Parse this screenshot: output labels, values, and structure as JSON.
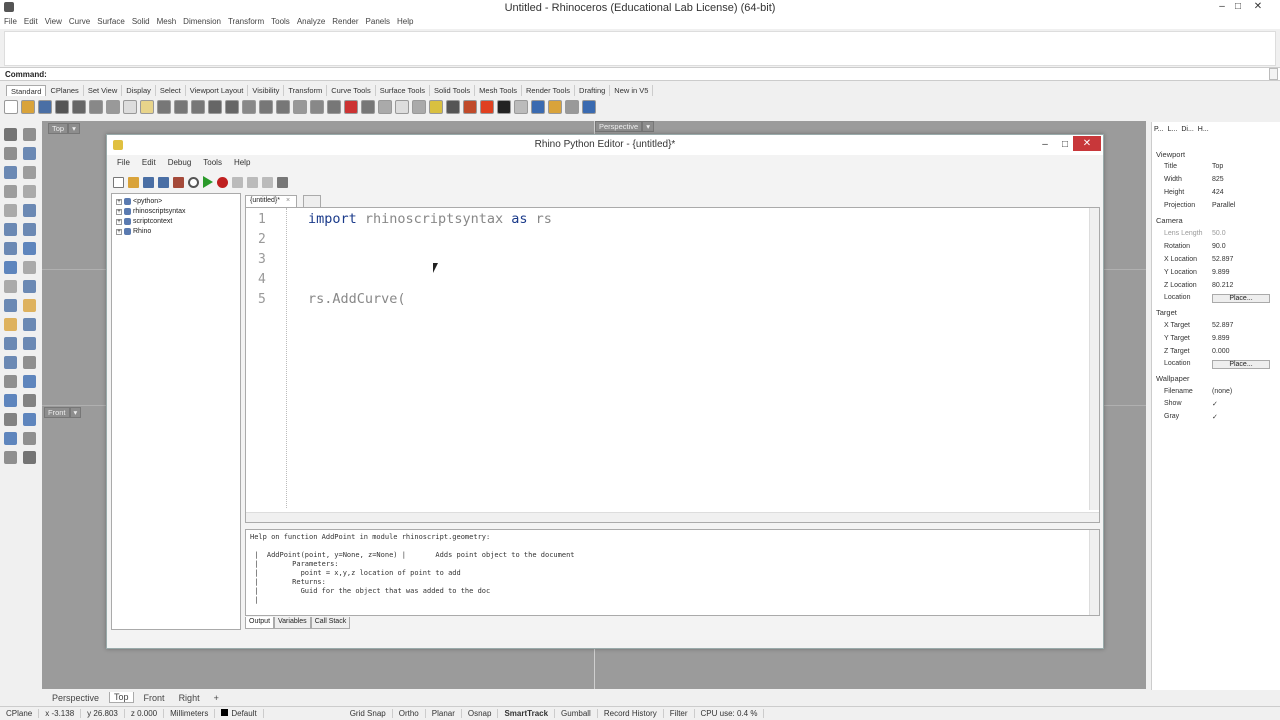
{
  "window": {
    "title": "Untitled - Rhinoceros (Educational Lab License) (64-bit)"
  },
  "menubar": [
    "File",
    "Edit",
    "View",
    "Curve",
    "Surface",
    "Solid",
    "Mesh",
    "Dimension",
    "Transform",
    "Tools",
    "Analyze",
    "Render",
    "Panels",
    "Help"
  ],
  "command": {
    "label": "Command:"
  },
  "toolbar_tabs": [
    "Standard",
    "CPlanes",
    "Set View",
    "Display",
    "Select",
    "Viewport Layout",
    "Visibility",
    "Transform",
    "Curve Tools",
    "Surface Tools",
    "Solid Tools",
    "Mesh Tools",
    "Render Tools",
    "Drafting",
    "New in V5"
  ],
  "viewports": {
    "top_label": "Top",
    "perspective_label": "Perspective",
    "front_label": "Front"
  },
  "python_editor": {
    "title": "Rhino Python Editor - {untitled}*",
    "menu": [
      "File",
      "Edit",
      "Debug",
      "Tools",
      "Help"
    ],
    "tree": [
      "<python>",
      "rhinoscriptsyntax",
      "scriptcontext",
      "Rhino"
    ],
    "tab": "{untitled}*",
    "line_numbers": [
      "1",
      "2",
      "3",
      "4",
      "5"
    ],
    "code": {
      "l1_kw1": "import",
      "l1_mid": " rhinoscriptsyntax ",
      "l1_kw2": "as",
      "l1_end": " rs",
      "l5": "rs.AddCurve("
    },
    "help": [
      "Help on function AddPoint in module rhinoscript.geometry:",
      "",
      " |  AddPoint(point, y=None, z=None) |       Adds point object to the document",
      " |        Parameters:",
      " |          point = x,y,z location of point to add",
      " |        Returns:",
      " |          Guid for the object that was added to the doc",
      " |"
    ],
    "output_tabs": [
      "Output",
      "Variables",
      "Call Stack"
    ]
  },
  "properties": {
    "tabs": [
      "P...",
      "L...",
      "Di...",
      "H..."
    ],
    "viewport_section": "Viewport",
    "camera_section": "Camera",
    "target_section": "Target",
    "wallpaper_section": "Wallpaper",
    "rows": {
      "title": {
        "label": "Title",
        "value": "Top"
      },
      "width": {
        "label": "Width",
        "value": "825"
      },
      "height": {
        "label": "Height",
        "value": "424"
      },
      "projection": {
        "label": "Projection",
        "value": "Parallel"
      },
      "lens": {
        "label": "Lens Length",
        "value": "50.0"
      },
      "rotation": {
        "label": "Rotation",
        "value": "90.0"
      },
      "xloc": {
        "label": "X Location",
        "value": "52.897"
      },
      "yloc": {
        "label": "Y Location",
        "value": "9.899"
      },
      "zloc": {
        "label": "Z Location",
        "value": "80.212"
      },
      "loc": {
        "label": "Location",
        "value": "Place..."
      },
      "xt": {
        "label": "X Target",
        "value": "52.897"
      },
      "yt": {
        "label": "Y Target",
        "value": "9.899"
      },
      "zt": {
        "label": "Z Target",
        "value": "0.000"
      },
      "tloc": {
        "label": "Location",
        "value": "Place..."
      },
      "filename": {
        "label": "Filename",
        "value": "(none)"
      },
      "show": {
        "label": "Show",
        "value": "✓"
      },
      "gray": {
        "label": "Gray",
        "value": "✓"
      }
    }
  },
  "viewport_tabs": [
    "Perspective",
    "Top",
    "Front",
    "Right"
  ],
  "status": {
    "cplane": "CPlane",
    "x": "x -3.138",
    "y": "y 26.803",
    "z": "z 0.000",
    "units": "Millimeters",
    "layer": "Default",
    "items": [
      "Grid Snap",
      "Ortho",
      "Planar",
      "Osnap",
      "SmartTrack",
      "Gumball",
      "Record History",
      "Filter"
    ],
    "cpu": "CPU use: 0.4 %"
  }
}
